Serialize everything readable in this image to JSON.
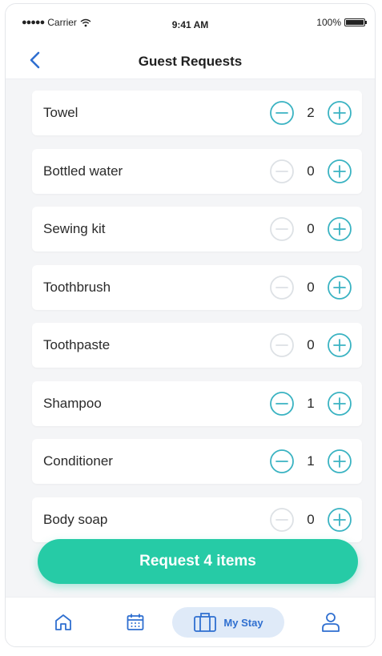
{
  "status_bar": {
    "carrier": "Carrier",
    "time": "9:41 AM",
    "battery": "100%",
    "battery_level": 1.0
  },
  "header": {
    "title": "Guest Requests"
  },
  "items": [
    {
      "label": "Towel",
      "quantity": "2"
    },
    {
      "label": "Bottled water",
      "quantity": "0"
    },
    {
      "label": "Sewing kit",
      "quantity": "0"
    },
    {
      "label": "Toothbrush",
      "quantity": "0"
    },
    {
      "label": "Toothpaste",
      "quantity": "0"
    },
    {
      "label": "Shampoo",
      "quantity": "1"
    },
    {
      "label": "Conditioner",
      "quantity": "1"
    },
    {
      "label": "Body soap",
      "quantity": "0"
    }
  ],
  "request_button": {
    "label": "Request 4 items"
  },
  "tab_bar": {
    "active_tab_label": "My Stay",
    "icons": [
      "home-icon",
      "calendar-icon",
      "suitcase-icon",
      "profile-icon"
    ]
  },
  "colors": {
    "accent_teal": "#26cba6",
    "stepper_active": "#3ab3c2",
    "stepper_disabled": "#dde1e5",
    "nav_blue": "#2f6fd0",
    "active_tab_bg": "#dfeaf8"
  }
}
